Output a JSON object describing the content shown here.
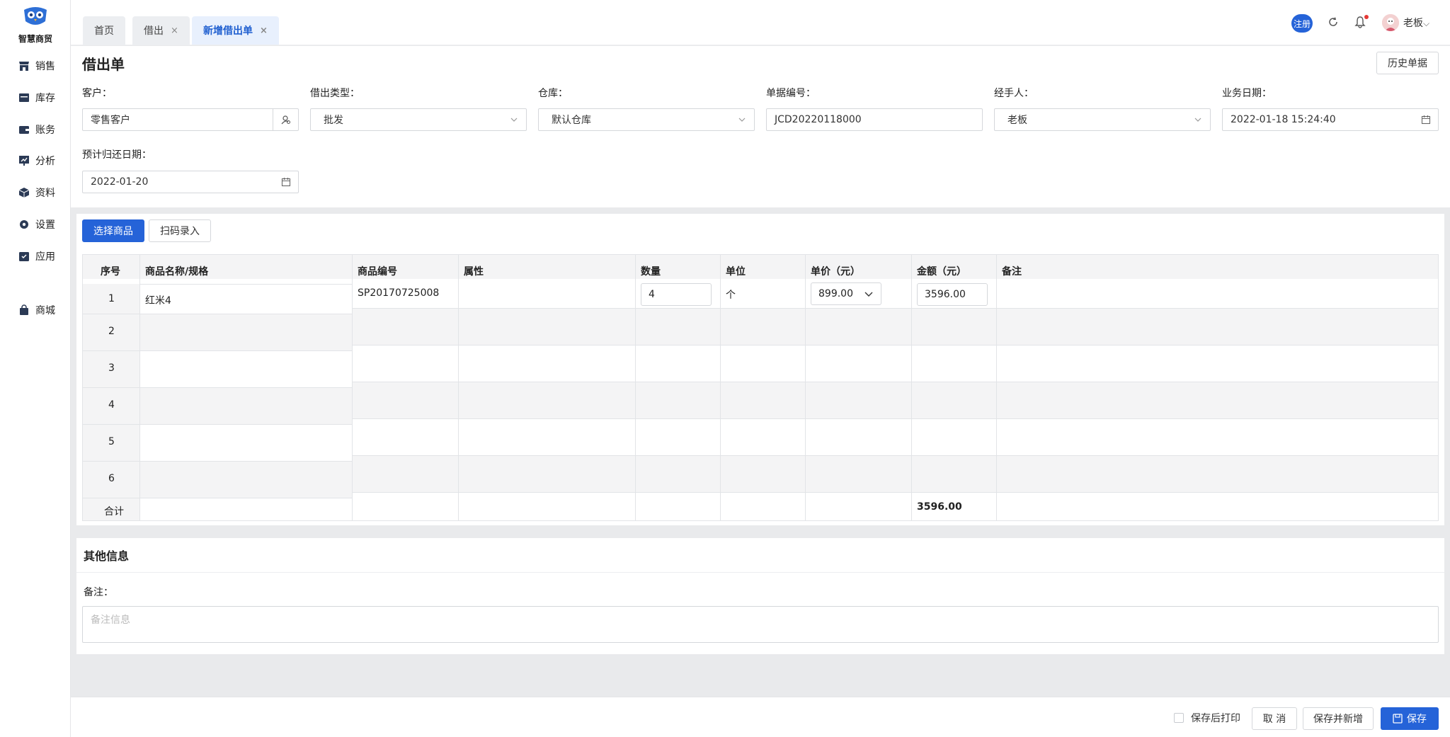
{
  "app": {
    "logo_text": "智慧商贸"
  },
  "sidebar": {
    "items": [
      {
        "label": "销售",
        "icon": "store-icon"
      },
      {
        "label": "库存",
        "icon": "inventory-icon"
      },
      {
        "label": "账务",
        "icon": "wallet-icon"
      },
      {
        "label": "分析",
        "icon": "chart-icon"
      },
      {
        "label": "资料",
        "icon": "box-icon"
      },
      {
        "label": "设置",
        "icon": "gear-icon"
      },
      {
        "label": "应用",
        "icon": "app-icon"
      },
      {
        "label": "商城",
        "icon": "bag-icon"
      }
    ]
  },
  "tabs": [
    {
      "label": "首页"
    },
    {
      "label": "借出",
      "close": "×"
    },
    {
      "label": "新增借出单",
      "close": "×"
    }
  ],
  "header": {
    "register_badge": "注册",
    "user_name": "老板",
    "user_caret": "⌵"
  },
  "form": {
    "title": "借出单",
    "history_button": "历史单据",
    "customer": {
      "label": "客户：",
      "value": "零售客户"
    },
    "loan_type": {
      "label": "借出类型：",
      "value": "批发"
    },
    "warehouse": {
      "label": "仓库：",
      "value": "默认仓库"
    },
    "doc_no": {
      "label": "单据编号：",
      "value": "JCD20220118000"
    },
    "handler": {
      "label": "经手人：",
      "value": "老板"
    },
    "biz_date": {
      "label": "业务日期：",
      "value": "2022-01-18 15:24:40"
    },
    "return_date": {
      "label": "预计归还日期：",
      "value": "2022-01-20"
    }
  },
  "goods": {
    "select_button": "选择商品",
    "scan_button": "扫码录入",
    "columns": [
      "序号",
      "商品名称/规格",
      "商品编号",
      "属性",
      "数量",
      "单位",
      "单价（元）",
      "金额（元）",
      "备注"
    ],
    "row_numbers": [
      "1",
      "2",
      "3",
      "4",
      "5",
      "6"
    ],
    "row1": {
      "name": "红米4",
      "code": "SP20170725008",
      "qty": "4",
      "unit": "个",
      "price": "899.00",
      "amount": "3596.00"
    },
    "total_label": "合计",
    "total_amount": "3596.00"
  },
  "other": {
    "title": "其他信息",
    "remark_label": "备注：",
    "remark_placeholder": "备注信息"
  },
  "footer": {
    "print_after_save": "保存后打印",
    "cancel": "取 消",
    "save_and_new": "保存并新增",
    "save": "保存"
  },
  "colors": {
    "primary": "#2563d8",
    "tab_active_text": "#1f5fd0",
    "notification_dot": "#e53935"
  }
}
